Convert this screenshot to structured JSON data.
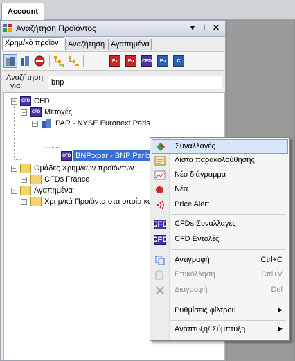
{
  "window": {
    "tab_label": "Account"
  },
  "panel": {
    "title": "Αναζήτηση Προϊόντος",
    "controls": {
      "dropdown": "▾",
      "pin": "⊥",
      "close": "✕"
    },
    "tabs": [
      {
        "label": "Χρημ/κό προϊόν",
        "active": true
      },
      {
        "label": "Αναζήτηση",
        "active": false
      },
      {
        "label": "Αγαπημένα",
        "active": false
      }
    ]
  },
  "toolbar": {
    "buttons": [
      {
        "icon": "exchange-icon",
        "selected": true
      },
      {
        "icon": "building-icon",
        "selected": false
      },
      {
        "icon": "stop-icon",
        "selected": false
      },
      {
        "icon": "tree-expand-icon",
        "selected": false
      },
      {
        "icon": "tree-collapse-icon",
        "selected": false
      },
      {
        "icon": "fx-icon",
        "label": "Fx",
        "selected": false
      },
      {
        "icon": "fu-red-icon",
        "label": "Fu",
        "selected": false
      },
      {
        "icon": "cfd-icon",
        "label": "CFD",
        "selected": false
      },
      {
        "icon": "fu-blue-icon",
        "label": "Fu",
        "selected": false
      },
      {
        "icon": "c-icon",
        "label": "C",
        "selected": false
      }
    ]
  },
  "search": {
    "label_line1": "Αναζήτηση",
    "label_line2": "για:",
    "value": "bnp"
  },
  "tree": {
    "cfd": "CFD",
    "stocks": "Μετοχές",
    "exchange": "PAR - NYSE Euronext Paris",
    "selected": "BNP:xpar - BNP Paribas",
    "groups": "Ομάδες Χρημ/κών προϊόντων",
    "group_child": "CFDs France",
    "favorites": "Αγαπημένα",
    "favorites_child": "Χρημ/κά Προϊόντα στα οποία κα",
    "icon_label": "CFD"
  },
  "context_menu": {
    "items": [
      {
        "label": "Συναλλαγές",
        "icon": "trade-icon",
        "highlighted": true
      },
      {
        "label": "Λίστα παρακολούθησης",
        "icon": "watchlist-icon"
      },
      {
        "label": "Νέο διάγραμμα",
        "icon": "chart-icon"
      },
      {
        "label": "Νέα",
        "icon": "news-icon"
      },
      {
        "label": "Price Alert",
        "icon": "alert-icon"
      },
      {
        "label": "CFDs Συναλλαγές",
        "icon": "cfd-icon"
      },
      {
        "label": "CFD Εντολές",
        "icon": "cfd-icon"
      },
      {
        "label": "Αντιγραφή",
        "icon": "copy-icon",
        "shortcut": "Ctrl+C"
      },
      {
        "label": "Επικόλληση",
        "icon": "paste-icon",
        "shortcut": "Ctrl+V",
        "disabled": true
      },
      {
        "label": "Διαγραφή",
        "icon": "delete-icon",
        "shortcut": "Del",
        "disabled": true
      },
      {
        "label": "Ρυθμίσεις φίλτρου",
        "submenu": true
      },
      {
        "label": "Ανάπτυξη/ Σύμπτυξη",
        "submenu": true
      }
    ]
  },
  "colors": {
    "selection": "#3a6ed6",
    "menu_highlight": "#d8e6fa",
    "cfd_icon": "#4b34a8"
  }
}
